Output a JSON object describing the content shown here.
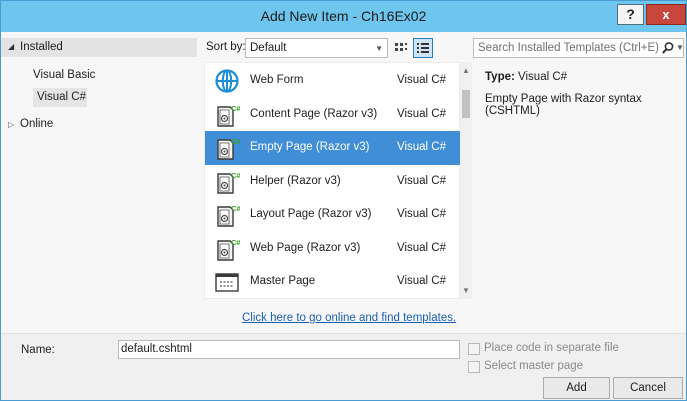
{
  "window": {
    "title": "Add New Item - Ch16Ex02",
    "help_label": "?",
    "close_label": "x"
  },
  "sidebar": {
    "installed_label": "Installed",
    "categories": [
      "Visual Basic",
      "Visual C#"
    ],
    "selected_category": "Visual C#",
    "online_label": "Online"
  },
  "toolbar": {
    "sort_label": "Sort by:",
    "sort_value": "Default"
  },
  "search": {
    "placeholder": "Search Installed Templates (Ctrl+E)"
  },
  "templates": [
    {
      "name": "Web Form",
      "lang": "Visual C#",
      "icon": "globe-icon"
    },
    {
      "name": "Content Page (Razor v3)",
      "lang": "Visual C#",
      "icon": "razor-page-icon"
    },
    {
      "name": "Empty Page (Razor v3)",
      "lang": "Visual C#",
      "icon": "razor-page-icon"
    },
    {
      "name": "Helper (Razor v3)",
      "lang": "Visual C#",
      "icon": "razor-page-icon"
    },
    {
      "name": "Layout Page (Razor v3)",
      "lang": "Visual C#",
      "icon": "razor-page-icon"
    },
    {
      "name": "Web Page (Razor v3)",
      "lang": "Visual C#",
      "icon": "razor-page-icon"
    },
    {
      "name": "Master Page",
      "lang": "Visual C#",
      "icon": "master-page-icon"
    }
  ],
  "selected_template": "Empty Page (Razor v3)",
  "online_link": "Click here to go online and find templates.",
  "info": {
    "type_label": "Type:",
    "type_value": "Visual C#",
    "description": "Empty Page with Razor syntax (CSHTML)"
  },
  "form": {
    "name_label": "Name:",
    "name_value": "default.cshtml",
    "place_code_label": "Place code in separate file",
    "select_master_label": "Select master page",
    "add_label": "Add",
    "cancel_label": "Cancel"
  },
  "colors": {
    "titlebar": "#6ec6ef",
    "selection": "#3f8ed6",
    "link": "#1a5fb4",
    "close": "#c9463d"
  }
}
